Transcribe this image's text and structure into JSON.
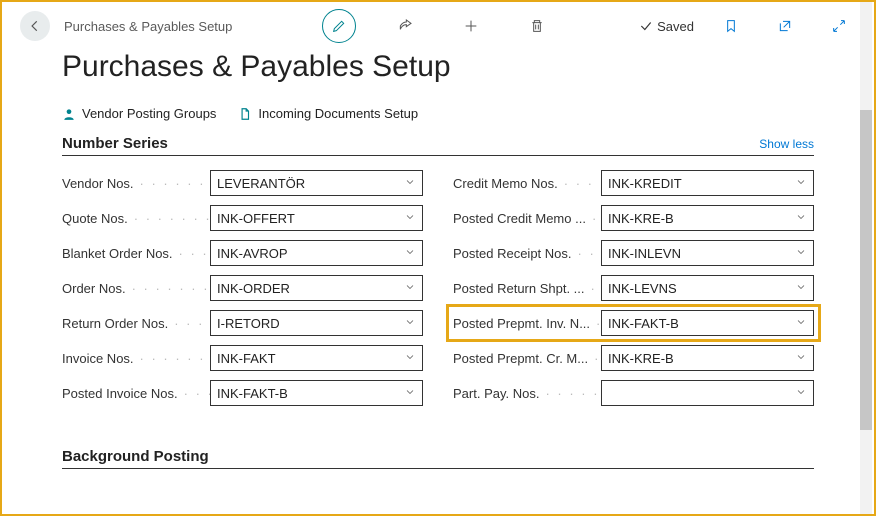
{
  "breadcrumb": "Purchases & Payables Setup",
  "title": "Purchases & Payables Setup",
  "statusSaved": "Saved",
  "links": {
    "vendorPosting": "Vendor Posting Groups",
    "incomingDocs": "Incoming Documents Setup"
  },
  "section1": {
    "title": "Number Series",
    "showLess": "Show less"
  },
  "fieldsLeft": [
    {
      "label": "Vendor Nos.",
      "value": "LEVERANTÖR"
    },
    {
      "label": "Quote Nos.",
      "value": "INK-OFFERT"
    },
    {
      "label": "Blanket Order Nos.",
      "value": "INK-AVROP"
    },
    {
      "label": "Order Nos.",
      "value": "INK-ORDER"
    },
    {
      "label": "Return Order Nos.",
      "value": "I-RETORD"
    },
    {
      "label": "Invoice Nos.",
      "value": "INK-FAKT"
    },
    {
      "label": "Posted Invoice Nos.",
      "value": "INK-FAKT-B"
    }
  ],
  "fieldsRight": [
    {
      "label": "Credit Memo Nos.",
      "value": "INK-KREDIT"
    },
    {
      "label": "Posted Credit Memo ...",
      "value": "INK-KRE-B"
    },
    {
      "label": "Posted Receipt Nos.",
      "value": "INK-INLEVN"
    },
    {
      "label": "Posted Return Shpt. ...",
      "value": "INK-LEVNS"
    },
    {
      "label": "Posted Prepmt. Inv. N...",
      "value": "INK-FAKT-B"
    },
    {
      "label": "Posted Prepmt. Cr. M...",
      "value": "INK-KRE-B"
    },
    {
      "label": "Part. Pay. Nos.",
      "value": ""
    }
  ],
  "section2": {
    "title": "Background Posting"
  }
}
